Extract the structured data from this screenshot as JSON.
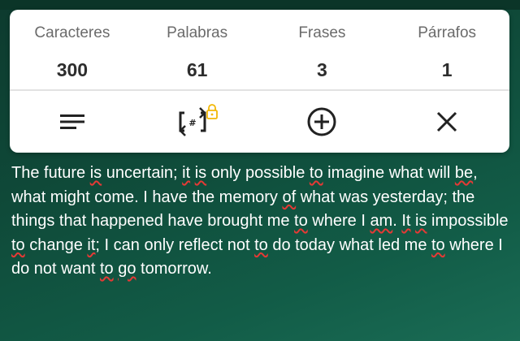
{
  "stats": [
    {
      "label": "Caracteres",
      "value": "300"
    },
    {
      "label": "Palabras",
      "value": "61"
    },
    {
      "label": "Frases",
      "value": "3"
    },
    {
      "label": "Párrafos",
      "value": "1"
    }
  ],
  "toolbar": {
    "icons": [
      "align-text-icon",
      "word-count-swap-icon",
      "lock-icon",
      "add-circle-icon",
      "close-icon"
    ],
    "lock_color": "#f2b705"
  },
  "text": {
    "segments": [
      {
        "t": "The future "
      },
      {
        "t": "is",
        "s": true
      },
      {
        "t": " uncertain; "
      },
      {
        "t": "it",
        "s": true
      },
      {
        "t": " "
      },
      {
        "t": "is",
        "s": true
      },
      {
        "t": " only possible "
      },
      {
        "t": "to",
        "s": true
      },
      {
        "t": " imagine what will "
      },
      {
        "t": "be",
        "s": true
      },
      {
        "t": ", what might come. I have the memory "
      },
      {
        "t": "of",
        "s": true
      },
      {
        "t": " what was yesterday; the things that happened have brought me "
      },
      {
        "t": "to",
        "s": true
      },
      {
        "t": " where I "
      },
      {
        "t": "am",
        "s": true
      },
      {
        "t": ". "
      },
      {
        "t": "It",
        "s": true
      },
      {
        "t": " "
      },
      {
        "t": "is",
        "s": true
      },
      {
        "t": " impossible "
      },
      {
        "t": "to",
        "s": true
      },
      {
        "t": " change "
      },
      {
        "t": "it",
        "s": true
      },
      {
        "t": "; I can only reflect not "
      },
      {
        "t": "to",
        "s": true
      },
      {
        "t": " do today what led me "
      },
      {
        "t": "to",
        "s": true
      },
      {
        "t": " where I do not want "
      },
      {
        "t": "to",
        "s": true
      },
      {
        "t": " "
      },
      {
        "t": "go",
        "s": true
      },
      {
        "t": " tomorrow."
      }
    ],
    "spellcheck_underline_color": "#e53935"
  }
}
